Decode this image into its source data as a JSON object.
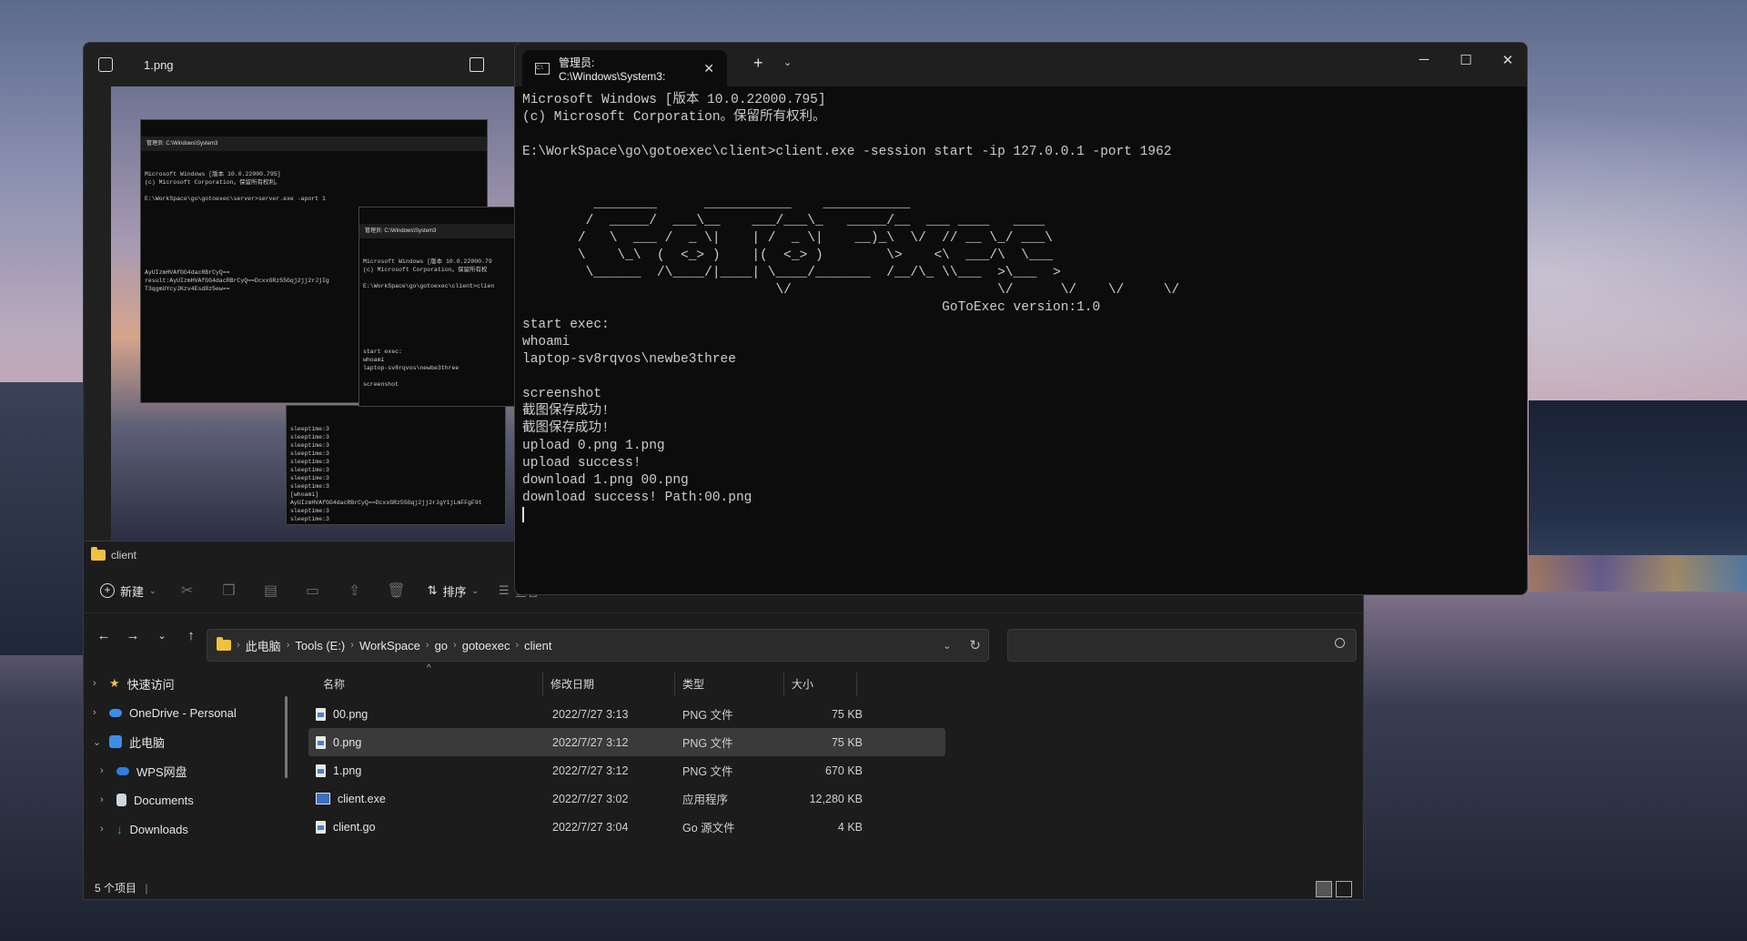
{
  "photos": {
    "filename": "1.png",
    "mini_server": {
      "tab": "管理员: C:\\Windows\\System3",
      "lines": "Microsoft Windows [版本 10.0.22000.795]\n(c) Microsoft Corporation。保留所有权利。\n\nE:\\WorkSpace\\go\\gotoexec\\server>server.exe -aport 1\n\n\n\n\n\n\n\n\nAyUIzmHVAfGG4dacRBrCyQ==\nresult:AyUIzmHVAfGG4dacRBrCyQ==DcxxGRz55Gqj2jj2rJjIg\nT3qgmUYcyJKzv4Esd8z5ew=="
    },
    "mini_client": {
      "tab": "管理员: C:\\Windows\\System3",
      "lines": "Microsoft Windows [版本 10.0.22000.79\n(c) Microsoft Corporation。保留所有权\n\nE:\\WorkSpace\\go\\gotoexec\\client>clien\n\n\n\n\n\n\n\nstart exec:\nwhoami\nlaptop-sv8rqvos\\newbe3three\n\nscreenshot"
    },
    "mini_log": {
      "lines": "sleeptime:3\nsleeptime:3\nsleeptime:3\nsleeptime:3\nsleeptime:3\nsleeptime:3\nsleeptime:3\nsleeptime:3\n[whoami]\nAyUIzmHVAfGG4dacRBrCyQ==DcxxGRz55Gqj2jj2rJgY1jLmFFgF9t\nsleeptime:3\nsleeptime:3"
    }
  },
  "explorer": {
    "window_title": "client",
    "toolbar": {
      "new_label": "新建",
      "sort_label": "排序",
      "view_label": "查看"
    },
    "breadcrumb": [
      "此电脑",
      "Tools (E:)",
      "WorkSpace",
      "go",
      "gotoexec",
      "client"
    ],
    "sidebar": [
      {
        "label": "快速访问",
        "icon": "star-icon",
        "color": "#f0c040",
        "indent": false
      },
      {
        "label": "OneDrive - Personal",
        "icon": "cloud-icon",
        "color": "#3a8ee6",
        "indent": false
      },
      {
        "label": "此电脑",
        "icon": "computer-icon",
        "color": "#3a8ee6",
        "indent": false,
        "expanded": true
      },
      {
        "label": "WPS网盘",
        "icon": "cloud-icon",
        "color": "#2f7de1",
        "indent": true
      },
      {
        "label": "Documents",
        "icon": "document-icon",
        "color": "#cfd6e4",
        "indent": true
      },
      {
        "label": "Downloads",
        "icon": "download-icon",
        "color": "#2fb37a",
        "indent": true
      }
    ],
    "columns": {
      "name": "名称",
      "date": "修改日期",
      "type": "类型",
      "size": "大小"
    },
    "files": [
      {
        "name": "00.png",
        "date": "2022/7/27 3:13",
        "type": "PNG 文件",
        "size": "75 KB",
        "selected": false,
        "kind": "file"
      },
      {
        "name": "0.png",
        "date": "2022/7/27 3:12",
        "type": "PNG 文件",
        "size": "75 KB",
        "selected": true,
        "kind": "file"
      },
      {
        "name": "1.png",
        "date": "2022/7/27 3:12",
        "type": "PNG 文件",
        "size": "670 KB",
        "selected": false,
        "kind": "file"
      },
      {
        "name": "client.exe",
        "date": "2022/7/27 3:02",
        "type": "应用程序",
        "size": "12,280 KB",
        "selected": false,
        "kind": "exe"
      },
      {
        "name": "client.go",
        "date": "2022/7/27 3:04",
        "type": "Go 源文件",
        "size": "4 KB",
        "selected": false,
        "kind": "file"
      }
    ],
    "status": "5 个项目"
  },
  "terminal": {
    "tab_title": "管理员: C:\\Windows\\System3:",
    "output": "Microsoft Windows [版本 10.0.22000.795]\n(c) Microsoft Corporation。保留所有权利。\n\nE:\\WorkSpace\\go\\gotoexec\\client>client.exe -session start -ip 127.0.0.1 -port 1962\n\n\n         ________      ___________    ___________\n        /  _____/  ___\\__    ___/___\\_   _____/__  ___ ____   ____\n       /   \\  ___ /  _ \\|    | /  _ \\|    __)_\\  \\/  // __ \\_/ ___\\\n       \\    \\_\\  (  <_> )    |(  <_> )        \\>    <\\  ___/\\  \\___\n        \\______  /\\____/|____| \\____/_______  /__/\\_ \\\\___  >\\___  >\n                                \\/                          \\/      \\/    \\/     \\/\n                                                     GoToExec version:1.0\nstart exec:\nwhoami\nlaptop-sv8rqvos\\newbe3three\n\nscreenshot\n截图保存成功!\n截图保存成功!\nupload 0.png 1.png\nupload success!\ndownload 1.png 00.png\ndownload success! Path:00.png"
  }
}
